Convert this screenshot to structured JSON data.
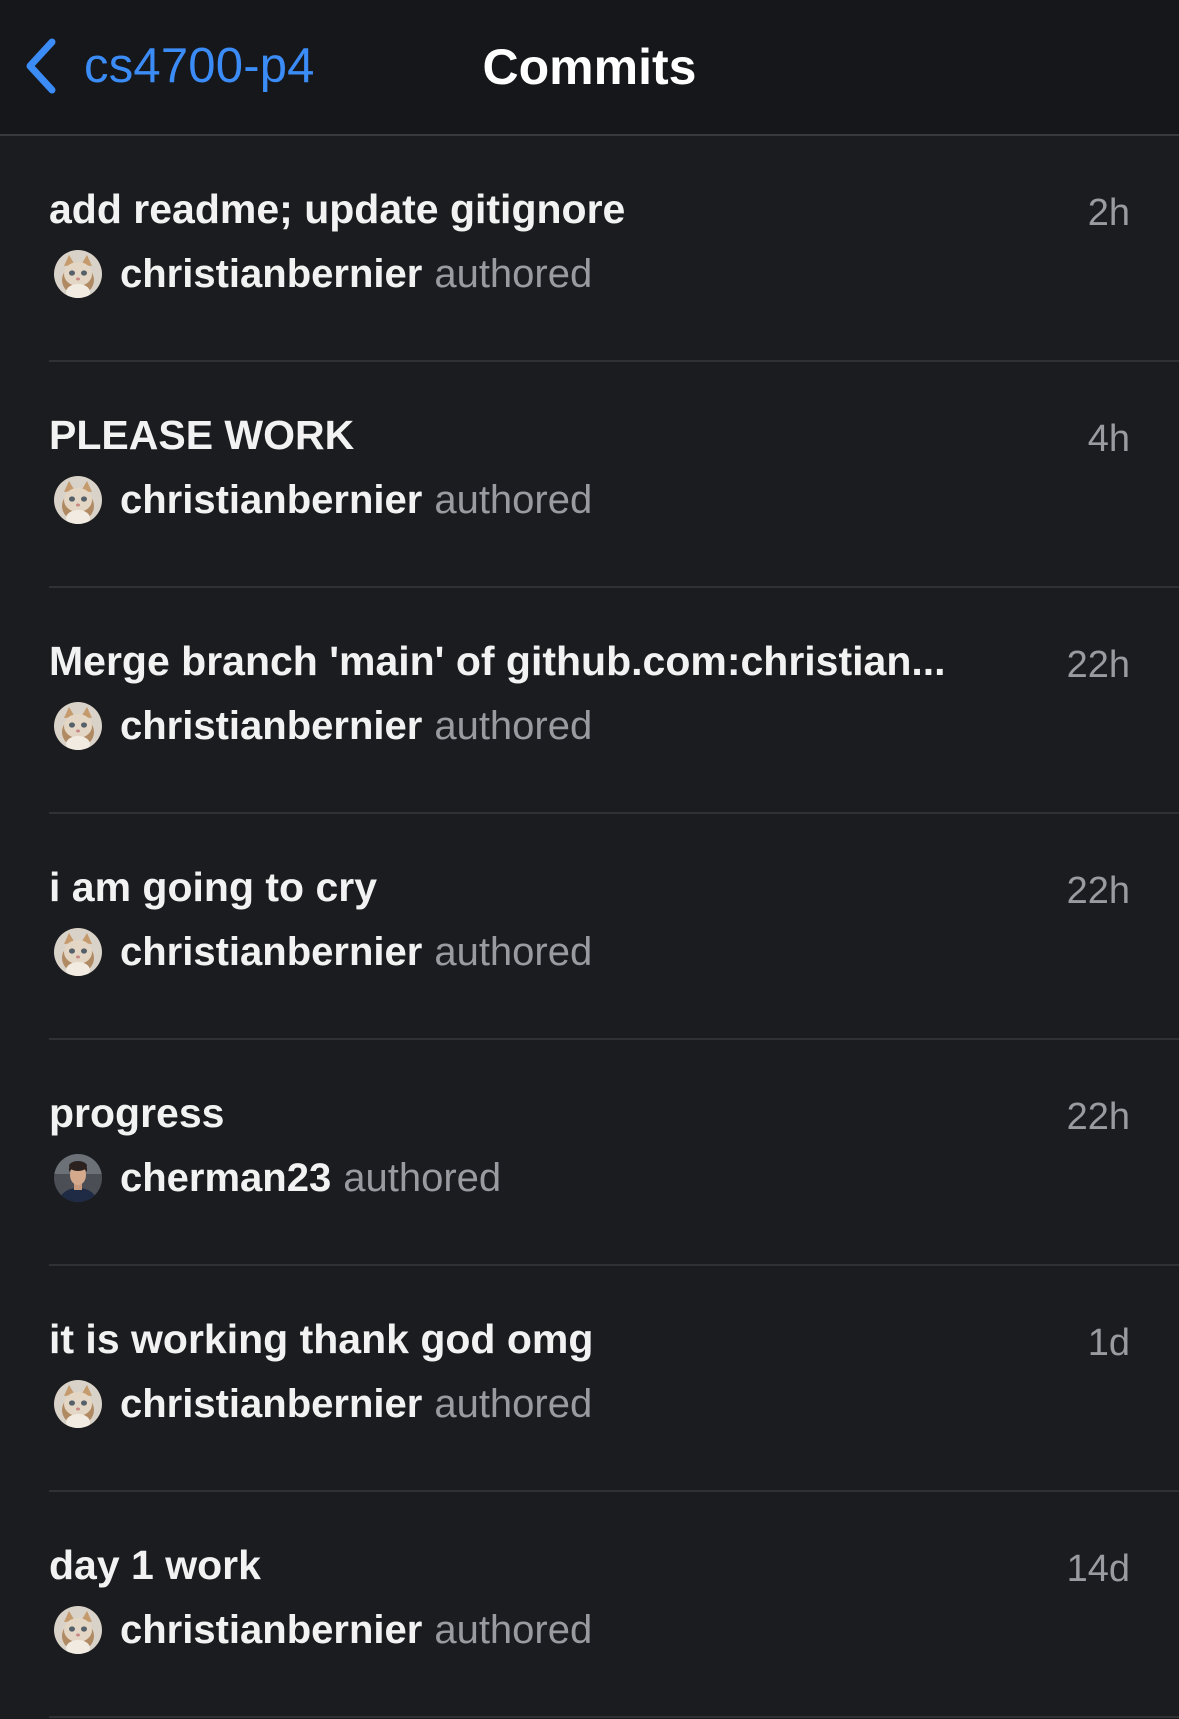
{
  "nav": {
    "back_label": "cs4700-p4",
    "title": "Commits"
  },
  "commits": [
    {
      "message": "add readme; update gitignore",
      "time": "2h",
      "author": "christianbernier",
      "verb": "authored",
      "avatar": "cat"
    },
    {
      "message": "PLEASE WORK",
      "time": "4h",
      "author": "christianbernier",
      "verb": "authored",
      "avatar": "cat"
    },
    {
      "message": "Merge branch 'main' of github.com:christian...",
      "time": "22h",
      "author": "christianbernier",
      "verb": "authored",
      "avatar": "cat"
    },
    {
      "message": "i am going to cry",
      "time": "22h",
      "author": "christianbernier",
      "verb": "authored",
      "avatar": "cat"
    },
    {
      "message": "progress",
      "time": "22h",
      "author": "cherman23",
      "verb": "authored",
      "avatar": "person"
    },
    {
      "message": "it is working thank god omg",
      "time": "1d",
      "author": "christianbernier",
      "verb": "authored",
      "avatar": "cat"
    },
    {
      "message": "day 1 work",
      "time": "14d",
      "author": "christianbernier",
      "verb": "authored",
      "avatar": "cat"
    }
  ],
  "colors": {
    "background": "#1b1c1f",
    "accent": "#3b8cf6",
    "secondary_text": "#9a9ba1",
    "separator": "#303135"
  },
  "icons": {
    "back": "chevron-left-icon"
  }
}
